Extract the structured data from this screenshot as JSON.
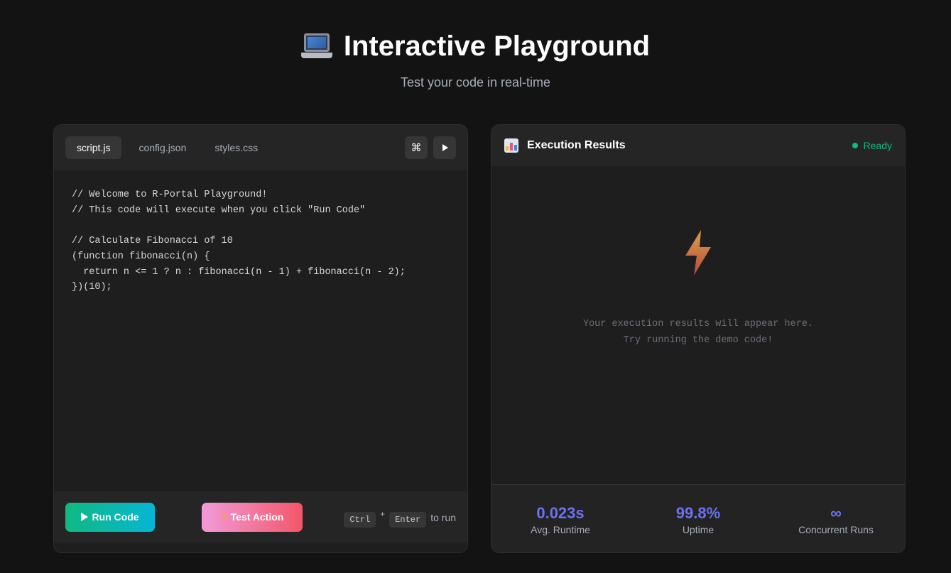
{
  "hero": {
    "icon": "laptop-icon",
    "title": "Interactive Playground",
    "subtitle": "Test your code in real-time"
  },
  "editor": {
    "tabs": [
      {
        "label": "script.js",
        "active": true
      },
      {
        "label": "config.json",
        "active": false
      },
      {
        "label": "styles.css",
        "active": false
      }
    ],
    "actions": {
      "command_icon": "command-icon",
      "command_glyph": "⌘",
      "play_icon": "play-icon"
    },
    "code": "// Welcome to R-Portal Playground!\n// This code will execute when you click \"Run Code\"\n\n// Calculate Fibonacci of 10\n(function fibonacci(n) {\n  return n <= 1 ? n : fibonacci(n - 1) + fibonacci(n - 2);\n})(10);",
    "footer": {
      "run_label": "Run Code",
      "test_label": "Test Action",
      "shortcut_key1": "Ctrl",
      "shortcut_plus": "+",
      "shortcut_key2": "Enter",
      "shortcut_suffix": "to run"
    }
  },
  "results": {
    "icon": "bar-chart-icon",
    "title": "Execution Results",
    "status": "Ready",
    "status_color": "#10b981",
    "placeholder_icon": "lightning-icon",
    "placeholder_line1": "Your execution results will appear here.",
    "placeholder_line2": "Try running the demo code!",
    "stats": [
      {
        "value": "0.023s",
        "label": "Avg. Runtime"
      },
      {
        "value": "99.8%",
        "label": "Uptime"
      },
      {
        "value": "∞",
        "label": "Concurrent Runs"
      }
    ]
  },
  "colors": {
    "background": "#131313",
    "panel": "#1e1e1e",
    "accent": "#6c72f0",
    "run_gradient": [
      "#10b981",
      "#06b6d4"
    ],
    "test_gradient": [
      "#f29bd8",
      "#f3566a"
    ]
  }
}
